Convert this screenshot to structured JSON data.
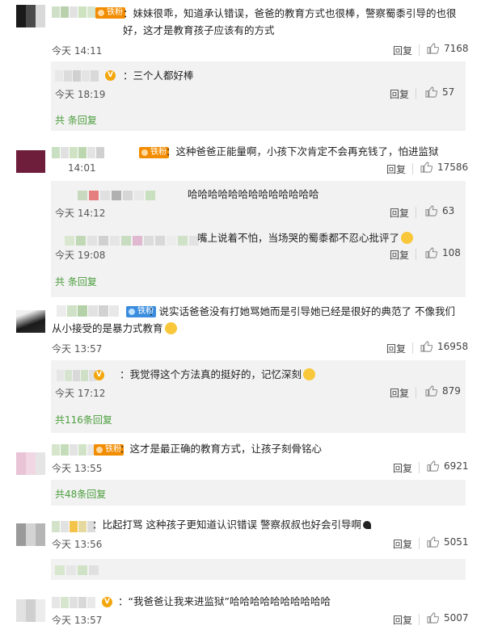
{
  "ui": {
    "reply_label": "回复",
    "badge_label": "铁粉"
  },
  "comments": [
    {
      "text": "：妹妹很乖，知道承认错误，爸爸的教育方式也很棒，警察蜀黍引导的也很好，这才是教育孩子应该有的方式",
      "time": "今天 14:11",
      "likes": "7168",
      "replies": [
        {
          "text": "：三个人都好棒",
          "time": "今天 18:19",
          "likes": "57"
        }
      ],
      "more": "共 条回复"
    },
    {
      "text": "：这种爸爸正能量啊，小孩下次肯定不会再充钱了，怕进监狱",
      "time": "14:01",
      "likes": "17586",
      "replies": [
        {
          "text": "哈哈哈哈哈哈哈哈哈哈哈哈哈",
          "time": "今天 14:12",
          "likes": "63"
        },
        {
          "text": "嘴上说着不怕，当场哭的蜀黍都不忍心批评了",
          "time": "今天 19:08",
          "likes": "108"
        }
      ],
      "more": "共 条回复"
    },
    {
      "text": "：说实话爸爸没有打她骂她而是引导她已经是很好的典范了 不像我们从小接受的是暴力式教育",
      "time": "今天 13:57",
      "likes": "16958",
      "replies": [
        {
          "text": "：我觉得这个方法真的挺好的，记忆深刻",
          "time": "今天 17:12",
          "likes": "879"
        }
      ],
      "more": "共116条回复"
    },
    {
      "text": "：这才是最正确的教育方式，让孩子刻骨铭心",
      "time": "今天 13:55",
      "likes": "6921",
      "replies": [],
      "more": "共48条回复"
    },
    {
      "text": "：比起打骂  这种孩子更知道认识错误 警察叔叔也好会引导啊",
      "time": "今天 13:56",
      "likes": "5051",
      "replies": [],
      "more": ""
    },
    {
      "text": "：“我爸爸让我来进监狱”哈哈哈哈哈哈哈哈哈哈",
      "time": "今天 13:57",
      "likes": "5007",
      "replies": [],
      "more": ""
    }
  ]
}
